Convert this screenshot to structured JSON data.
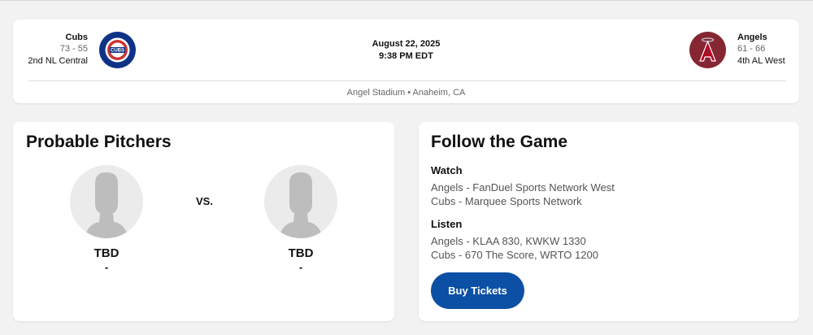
{
  "game": {
    "away": {
      "name": "Cubs",
      "record": "73 - 55",
      "standing": "2nd NL Central",
      "logo": "cubs-logo-icon"
    },
    "home": {
      "name": "Angels",
      "record": "61 - 66",
      "standing": "4th AL West",
      "logo": "angels-logo-icon"
    },
    "date": "August 22, 2025",
    "time": "9:38 PM EDT",
    "venue": "Angel Stadium • Anaheim, CA"
  },
  "pitchers": {
    "title": "Probable Pitchers",
    "vs_label": "VS.",
    "away": {
      "name": "TBD",
      "sub": "-"
    },
    "home": {
      "name": "TBD",
      "sub": "-"
    }
  },
  "follow": {
    "title": "Follow the Game",
    "watch_label": "Watch",
    "watch": [
      "Angels - FanDuel Sports Network West",
      "Cubs - Marquee Sports Network"
    ],
    "listen_label": "Listen",
    "listen": [
      "Angels - KLAA 830, KWKW 1330",
      "Cubs - 670 The Score, WRTO 1200"
    ],
    "buy_label": "Buy Tickets"
  },
  "colors": {
    "cubs_blue": "#0e3386",
    "cubs_red": "#cc3433",
    "angels_red": "#862633",
    "button_blue": "#0b50a5"
  }
}
